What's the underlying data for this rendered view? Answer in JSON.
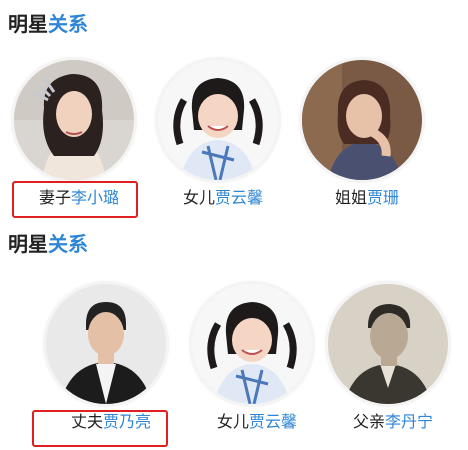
{
  "sections": [
    {
      "title_plain": "明星",
      "title_highlight": "关系",
      "cards": [
        {
          "relation": "妻子",
          "name": "李小璐"
        },
        {
          "relation": "女儿",
          "name": "贾云馨"
        },
        {
          "relation": "姐姐",
          "name": "贾珊"
        }
      ]
    },
    {
      "title_plain": "明星",
      "title_highlight": "关系",
      "cards": [
        {
          "relation": "丈夫",
          "name": "贾乃亮"
        },
        {
          "relation": "女儿",
          "name": "贾云馨"
        },
        {
          "relation": "父亲",
          "name": "李丹宁"
        }
      ]
    }
  ],
  "colors": {
    "name_link": "#2f86d6",
    "highlight_box": "#e02020",
    "title_text": "#222222"
  }
}
